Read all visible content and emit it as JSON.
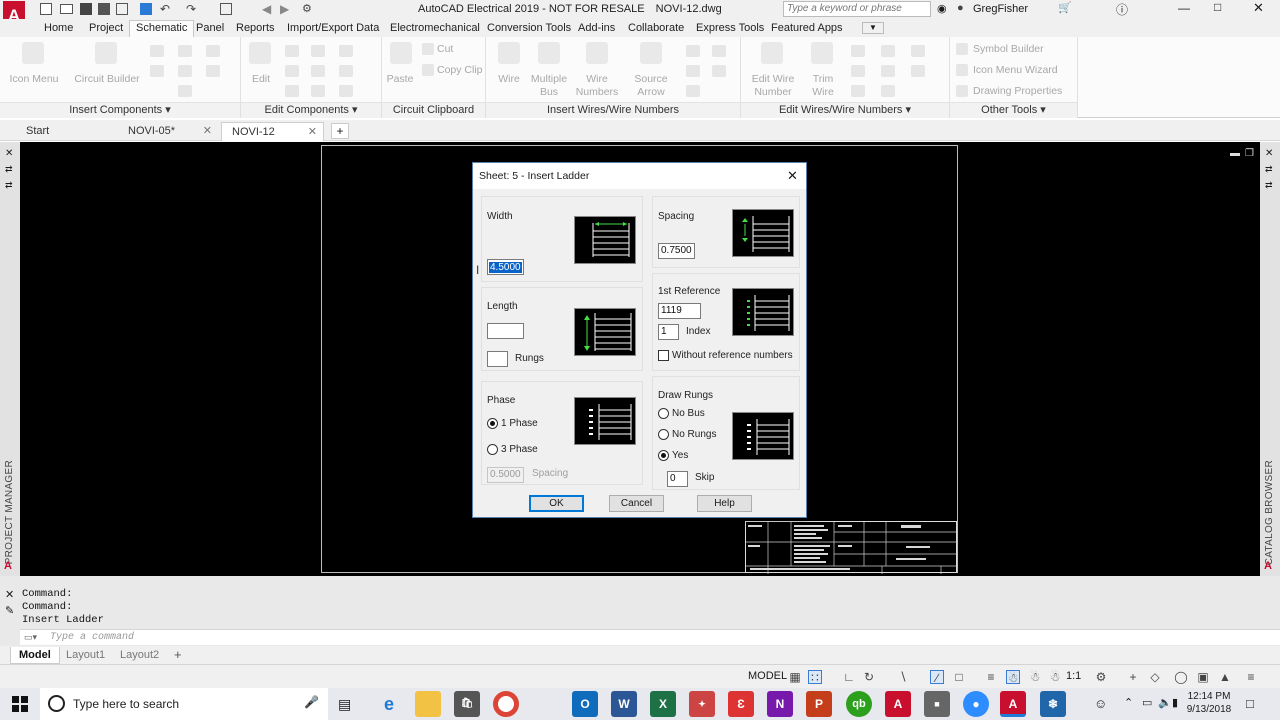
{
  "app": {
    "title": "AutoCAD Electrical 2019 - NOT FOR RESALE",
    "filename": "NOVI-12.dwg",
    "search_placeholder": "Type a keyword or phrase",
    "user": "GregFisher",
    "logo_letter": "A"
  },
  "ribbon_tabs": [
    "Home",
    "Project",
    "Schematic",
    "Panel",
    "Reports",
    "Import/Export Data",
    "Electromechanical",
    "Conversion Tools",
    "Add-ins",
    "Collaborate",
    "Express Tools",
    "Featured Apps"
  ],
  "ribbon": {
    "insert_components": {
      "title": "Insert Components",
      "icon_menu": "Icon Menu",
      "circuit_builder": "Circuit Builder"
    },
    "edit_components": {
      "title": "Edit Components",
      "edit": "Edit"
    },
    "circuit_clipboard": {
      "title": "Circuit Clipboard",
      "paste": "Paste",
      "cut": "Cut",
      "copy_clip": "Copy Clip"
    },
    "insert_wires": {
      "title": "Insert Wires/Wire Numbers",
      "wire": "Wire",
      "multiple_bus_1": "Multiple",
      "multiple_bus_2": "Bus",
      "wire_numbers_1": "Wire",
      "wire_numbers_2": "Numbers",
      "source_arrow_1": "Source",
      "source_arrow_2": "Arrow"
    },
    "edit_wires": {
      "title": "Edit Wires/Wire Numbers",
      "edit_wire_number_1": "Edit Wire",
      "edit_wire_number_2": "Number",
      "trim_wire_1": "Trim",
      "trim_wire_2": "Wire"
    },
    "other_tools": {
      "title": "Other Tools",
      "symbol_builder": "Symbol Builder",
      "icon_menu_wizard": "Icon Menu  Wizard",
      "drawing_properties": "Drawing  Properties"
    }
  },
  "doc_tabs": [
    {
      "label": "Start"
    },
    {
      "label": "NOVI-05*"
    },
    {
      "label": "NOVI-12"
    }
  ],
  "side_labels": {
    "left": "PROJECT MANAGER",
    "right": "CATALOG BROWSER"
  },
  "dialog": {
    "title": "Sheet: 5 - Insert Ladder",
    "width": {
      "label": "Width",
      "value": "4.5000"
    },
    "spacing": {
      "label": "Spacing",
      "value": "0.7500"
    },
    "length": {
      "label": "Length",
      "value": "",
      "rungs_label": "Rungs",
      "rungs_value": ""
    },
    "reference": {
      "label": "1st Reference",
      "value": "1119",
      "index_value": "1",
      "index_label": "Index",
      "without_label": "Without reference numbers",
      "without_checked": false
    },
    "phase": {
      "label": "Phase",
      "one": "1 Phase",
      "three": "3 Phase",
      "selected": "1 Phase",
      "spacing_value": "0.5000",
      "spacing_label": "Spacing"
    },
    "draw_rungs": {
      "label": "Draw Rungs",
      "no_bus": "No Bus",
      "no_rungs": "No Rungs",
      "yes": "Yes",
      "selected": "Yes",
      "skip_value": "0",
      "skip_label": "Skip"
    },
    "ok": "OK",
    "cancel": "Cancel",
    "help": "Help"
  },
  "command": {
    "history": [
      "Command:",
      "Command:",
      "Insert Ladder"
    ],
    "placeholder": "Type a command"
  },
  "layout_tabs": [
    "Model",
    "Layout1",
    "Layout2"
  ],
  "status": {
    "model": "MODEL",
    "scale": "1:1"
  },
  "taskbar": {
    "search": "Type here to search",
    "time": "12:14 PM",
    "date": "9/13/2018"
  },
  "colors": {
    "accent": "#c8102e",
    "dialog_border": "#5a7fb0",
    "green": "#44dd44",
    "selection": "#0a64c8"
  }
}
